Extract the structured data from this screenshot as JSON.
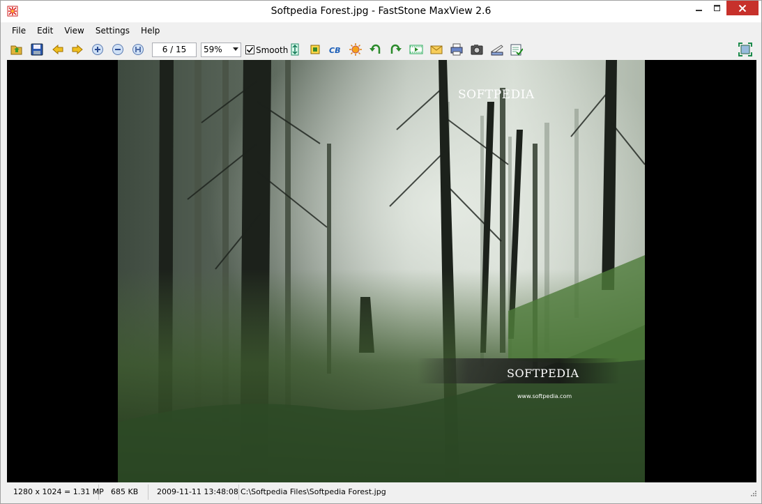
{
  "window": {
    "title": "Softpedia Forest.jpg - FastStone MaxView 2.6"
  },
  "menu": [
    "File",
    "Edit",
    "View",
    "Settings",
    "Help"
  ],
  "toolbar": {
    "page_indicator": "6 / 15",
    "zoom_value": "59%",
    "smooth_checked": true,
    "smooth_label": "Smooth",
    "icons": [
      "open-folder-icon",
      "save-icon",
      "previous-icon",
      "next-icon",
      "zoom-in-icon",
      "zoom-out-icon",
      "actual-size-icon",
      "resize-icon",
      "crop-icon",
      "color-balance-icon",
      "adjust-lighting-icon",
      "rotate-left-icon",
      "rotate-right-icon",
      "slideshow-icon",
      "email-icon",
      "print-icon",
      "screen-capture-icon",
      "scanner-icon",
      "batch-convert-icon",
      "full-screen-icon"
    ]
  },
  "image": {
    "watermark_top": "SOFTPEDIA",
    "watermark_mid": "SOFTPEDIA",
    "watermark_url": "www.softpedia.com"
  },
  "status": {
    "dimensions": "1280 x 1024 = 1.31 MP",
    "file_size": "685 KB",
    "date": "2009-11-11 13:48:08",
    "path": "C:\\Softpedia Files\\Softpedia Forest.jpg"
  },
  "colors": {
    "close_button": "#c7312b",
    "viewer_background": "#000000"
  }
}
